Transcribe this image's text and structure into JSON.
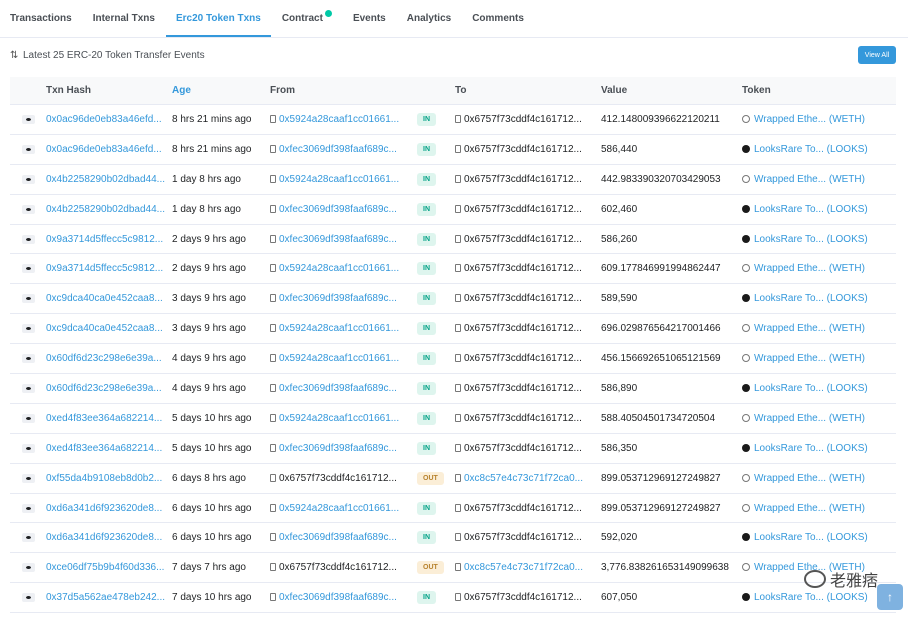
{
  "tabs": [
    {
      "label": "Transactions",
      "active": false
    },
    {
      "label": "Internal Txns",
      "active": false
    },
    {
      "label": "Erc20 Token Txns",
      "active": true
    },
    {
      "label": "Contract",
      "active": false
    },
    {
      "label": "Events",
      "active": false
    },
    {
      "label": "Analytics",
      "active": false
    },
    {
      "label": "Comments",
      "active": false
    }
  ],
  "toolbar": {
    "summary": "Latest 25 ERC-20 Token Transfer Events",
    "view_all": "View All"
  },
  "columns": {
    "hash": "Txn Hash",
    "age": "Age",
    "from": "From",
    "to": "To",
    "value": "Value",
    "token": "Token"
  },
  "rows": [
    {
      "hash": "0x0ac96de0eb83a46efd...",
      "age": "8 hrs 21 mins ago",
      "from": "0x5924a28caaf1cc01661...",
      "from_link": true,
      "dir": "IN",
      "to": "0x6757f73cddf4c161712...",
      "to_link": false,
      "value": "412.148009396622120211",
      "token": "Wrapped Ethe... (WETH)",
      "token_icon": "weth"
    },
    {
      "hash": "0x0ac96de0eb83a46efd...",
      "age": "8 hrs 21 mins ago",
      "from": "0xfec3069df398faaf689c...",
      "from_link": true,
      "dir": "IN",
      "to": "0x6757f73cddf4c161712...",
      "to_link": false,
      "value": "586,440",
      "token": "LooksRare To... (LOOKS)",
      "token_icon": "looks"
    },
    {
      "hash": "0x4b2258290b02dbad44...",
      "age": "1 day 8 hrs ago",
      "from": "0x5924a28caaf1cc01661...",
      "from_link": true,
      "dir": "IN",
      "to": "0x6757f73cddf4c161712...",
      "to_link": false,
      "value": "442.983390320703429053",
      "token": "Wrapped Ethe... (WETH)",
      "token_icon": "weth"
    },
    {
      "hash": "0x4b2258290b02dbad44...",
      "age": "1 day 8 hrs ago",
      "from": "0xfec3069df398faaf689c...",
      "from_link": true,
      "dir": "IN",
      "to": "0x6757f73cddf4c161712...",
      "to_link": false,
      "value": "602,460",
      "token": "LooksRare To... (LOOKS)",
      "token_icon": "looks"
    },
    {
      "hash": "0x9a3714d5ffecc5c9812...",
      "age": "2 days 9 hrs ago",
      "from": "0xfec3069df398faaf689c...",
      "from_link": true,
      "dir": "IN",
      "to": "0x6757f73cddf4c161712...",
      "to_link": false,
      "value": "586,260",
      "token": "LooksRare To... (LOOKS)",
      "token_icon": "looks"
    },
    {
      "hash": "0x9a3714d5ffecc5c9812...",
      "age": "2 days 9 hrs ago",
      "from": "0x5924a28caaf1cc01661...",
      "from_link": true,
      "dir": "IN",
      "to": "0x6757f73cddf4c161712...",
      "to_link": false,
      "value": "609.177846991994862447",
      "token": "Wrapped Ethe... (WETH)",
      "token_icon": "weth"
    },
    {
      "hash": "0xc9dca40ca0e452caa8...",
      "age": "3 days 9 hrs ago",
      "from": "0xfec3069df398faaf689c...",
      "from_link": true,
      "dir": "IN",
      "to": "0x6757f73cddf4c161712...",
      "to_link": false,
      "value": "589,590",
      "token": "LooksRare To... (LOOKS)",
      "token_icon": "looks"
    },
    {
      "hash": "0xc9dca40ca0e452caa8...",
      "age": "3 days 9 hrs ago",
      "from": "0x5924a28caaf1cc01661...",
      "from_link": true,
      "dir": "IN",
      "to": "0x6757f73cddf4c161712...",
      "to_link": false,
      "value": "696.029876564217001466",
      "token": "Wrapped Ethe... (WETH)",
      "token_icon": "weth"
    },
    {
      "hash": "0x60df6d23c298e6e39a...",
      "age": "4 days 9 hrs ago",
      "from": "0x5924a28caaf1cc01661...",
      "from_link": true,
      "dir": "IN",
      "to": "0x6757f73cddf4c161712...",
      "to_link": false,
      "value": "456.156692651065121569",
      "token": "Wrapped Ethe... (WETH)",
      "token_icon": "weth"
    },
    {
      "hash": "0x60df6d23c298e6e39a...",
      "age": "4 days 9 hrs ago",
      "from": "0xfec3069df398faaf689c...",
      "from_link": true,
      "dir": "IN",
      "to": "0x6757f73cddf4c161712...",
      "to_link": false,
      "value": "586,890",
      "token": "LooksRare To... (LOOKS)",
      "token_icon": "looks"
    },
    {
      "hash": "0xed4f83ee364a682214...",
      "age": "5 days 10 hrs ago",
      "from": "0x5924a28caaf1cc01661...",
      "from_link": true,
      "dir": "IN",
      "to": "0x6757f73cddf4c161712...",
      "to_link": false,
      "value": "588.40504501734720504",
      "token": "Wrapped Ethe... (WETH)",
      "token_icon": "weth"
    },
    {
      "hash": "0xed4f83ee364a682214...",
      "age": "5 days 10 hrs ago",
      "from": "0xfec3069df398faaf689c...",
      "from_link": true,
      "dir": "IN",
      "to": "0x6757f73cddf4c161712...",
      "to_link": false,
      "value": "586,350",
      "token": "LooksRare To... (LOOKS)",
      "token_icon": "looks"
    },
    {
      "hash": "0xf55da4b9108eb8d0b2...",
      "age": "6 days 8 hrs ago",
      "from": "0x6757f73cddf4c161712...",
      "from_link": false,
      "dir": "OUT",
      "to": "0xc8c57e4c73c71f72ca0...",
      "to_link": true,
      "value": "899.053712969127249827",
      "token": "Wrapped Ethe... (WETH)",
      "token_icon": "weth"
    },
    {
      "hash": "0xd6a341d6f923620de8...",
      "age": "6 days 10 hrs ago",
      "from": "0x5924a28caaf1cc01661...",
      "from_link": true,
      "dir": "IN",
      "to": "0x6757f73cddf4c161712...",
      "to_link": false,
      "value": "899.053712969127249827",
      "token": "Wrapped Ethe... (WETH)",
      "token_icon": "weth"
    },
    {
      "hash": "0xd6a341d6f923620de8...",
      "age": "6 days 10 hrs ago",
      "from": "0xfec3069df398faaf689c...",
      "from_link": true,
      "dir": "IN",
      "to": "0x6757f73cddf4c161712...",
      "to_link": false,
      "value": "592,020",
      "token": "LooksRare To... (LOOKS)",
      "token_icon": "looks"
    },
    {
      "hash": "0xce06df75b9b4f60d336...",
      "age": "7 days 7 hrs ago",
      "from": "0x6757f73cddf4c161712...",
      "from_link": false,
      "dir": "OUT",
      "to": "0xc8c57e4c73c71f72ca0...",
      "to_link": true,
      "value": "3,776.838261653149099638",
      "token": "Wrapped Ethe... (WETH)",
      "token_icon": "weth"
    },
    {
      "hash": "0x37d5a562ae478eb242...",
      "age": "7 days 10 hrs ago",
      "from": "0xfec3069df398faaf689c...",
      "from_link": true,
      "dir": "IN",
      "to": "0x6757f73cddf4c161712...",
      "to_link": false,
      "value": "607,050",
      "token": "LooksRare To... (LOOKS)",
      "token_icon": "looks"
    }
  ],
  "watermark": "老雅痞",
  "colors": {
    "accent": "#3498db",
    "in_badge": "#def5ee",
    "out_badge": "#fbeed7"
  }
}
